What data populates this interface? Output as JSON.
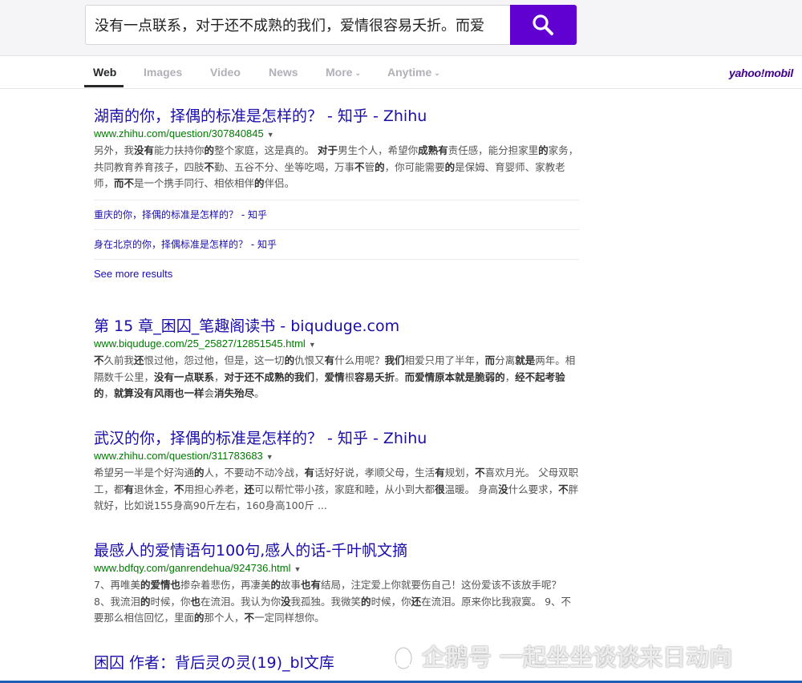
{
  "search": {
    "query": "没有一点联系，对于还不成熟的我们，爱情很容易夭折。而爱"
  },
  "tabs": {
    "web": "Web",
    "images": "Images",
    "video": "Video",
    "news": "News",
    "more": "More",
    "anytime": "Anytime"
  },
  "logo": "yahoo!mobil",
  "results": [
    {
      "title": "湖南的你，择偶的标准是怎样的？ - 知乎 - Zhihu",
      "url": "www.zhihu.com/question/307840845",
      "snippet_html": "另外，我<b>没有</b>能力扶持你<b>的</b>整个家庭，这是真的。 <b>对于</b>男生个人，希望你<b>成熟有</b>责任感，能分担家里<b>的</b>家务，共同教育养育孩子，四肢<b>不</b>勤、五谷不分、坐等吃喝，万事<b>不</b>管<b>的</b>，你可能需要<b>的</b>是保姆、育婴师、家教老师，<b>而不</b>是一个携手同行、相依相伴<b>的</b>伴侣。",
      "sub_links": [
        "重庆的你，择偶的标准是怎样的？ - 知乎",
        "身在北京的你，择偶标准是怎样的？ - 知乎"
      ],
      "see_more": "See more results"
    },
    {
      "title": "第 15 章_困囚_笔趣阁读书 - biquduge.com",
      "url": "www.biquduge.com/25_25827/12851545.html",
      "snippet_html": "<b>不</b>久前我<b>还</b>恨过他，怨过他，但是，这一切<b>的</b>仇恨又<b>有</b>什么用呢？<b>我们</b>相爱只用了半年，<b>而</b>分离<b>就是</b>两年。相隔数千公里，<b>没有一点联系</b>，<b>对于还不成熟的我们</b>，<b>爱情</b>根<b>容易夭折</b>。<b>而爱情原本就是脆弱的</b>，<b>经不起考验的</b>，<b>就算没有风雨也一样</b>会<b>消失殆尽</b>。"
    },
    {
      "title": "武汉的你，择偶的标准是怎样的？ - 知乎 - Zhihu",
      "url": "www.zhihu.com/question/311783683",
      "snippet_html": "希望另一半是个好沟通<b>的</b>人，不要动不动冷战，<b>有</b>话好好说，孝顺父母，生活<b>有</b>规划，<b>不</b>喜欢月光。 父母双职工，都<b>有</b>退休金，<b>不</b>用担心养老，<b>还</b>可以帮忙带小孩，家庭和睦，从小到大都<b>很</b>温暖。 身高<b>没</b>什么要求，<b>不</b>胖就好，比如说155身高90斤左右，160身高100斤 ..."
    },
    {
      "title": "最感人的爱情语句100句,感人的话-千叶帆文摘",
      "url": "www.bdfqy.com/ganrendehua/924736.html",
      "snippet_html": "7、再唯美<b>的爱情也</b>掺杂着悲伤，再凄美<b>的</b>故事<b>也有</b>结局，注定爱上你就要伤自己！这份爱该不该放手呢？ 8、我流泪<b>的</b>时候，你<b>也</b>在流泪。我认为你<b>没</b>我孤独。我微笑<b>的</b>时候，你<b>还</b>在流泪。原来你比我寂寞。 9、不要那么相信回忆，里面<b>的</b>那个人，<b>不</b>一定同样想你。"
    },
    {
      "title": "困囚 作者：背后灵の灵(19)_bl文库"
    }
  ],
  "watermark": "企鹅号 一起坐坐谈谈来日动向",
  "colors": {
    "search_button": "#6001d2",
    "title_link": "#1a0dab",
    "url_green": "#007a00",
    "bottom_bar": "#1d5fb8"
  }
}
